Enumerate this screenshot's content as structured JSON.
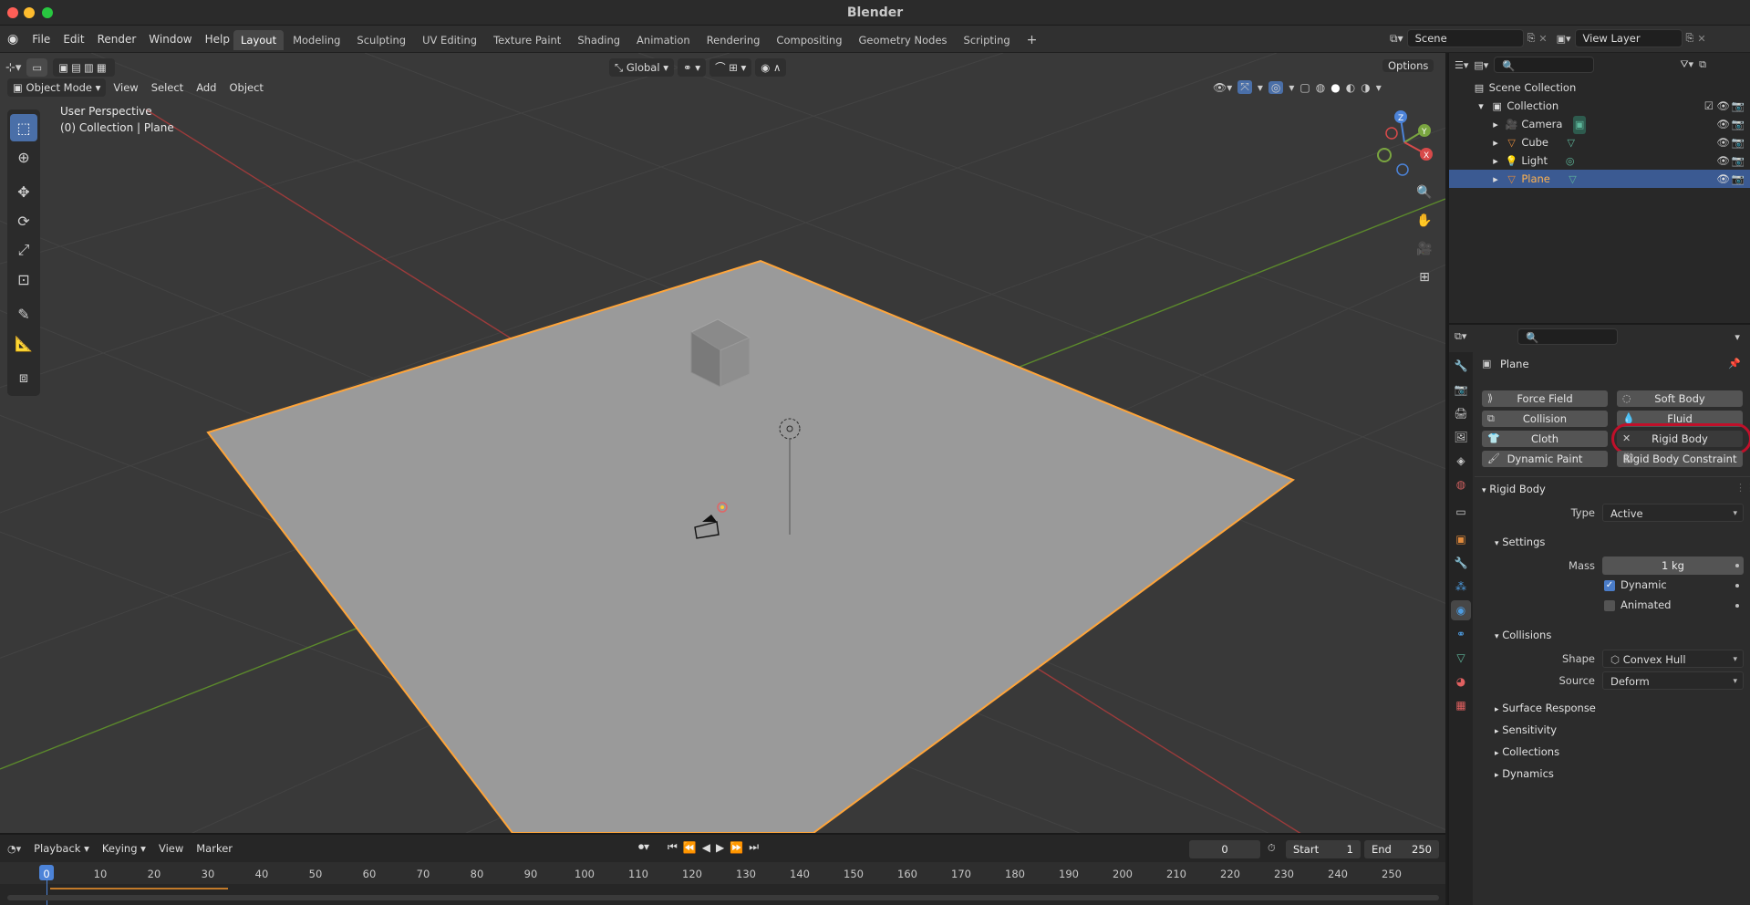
{
  "window": {
    "title": "Blender"
  },
  "menubar": {
    "menus": [
      "File",
      "Edit",
      "Render",
      "Window",
      "Help"
    ],
    "workspaces": [
      "Layout",
      "Modeling",
      "Sculpting",
      "UV Editing",
      "Texture Paint",
      "Shading",
      "Animation",
      "Rendering",
      "Compositing",
      "Geometry Nodes",
      "Scripting"
    ],
    "active_workspace": "Layout",
    "scene": "Scene",
    "view_layer": "View Layer"
  },
  "viewport": {
    "mode": "Object Mode",
    "menus": [
      "View",
      "Select",
      "Add",
      "Object"
    ],
    "transform_orientation": "Global",
    "options_label": "Options",
    "info_line1": "User Perspective",
    "info_line2": "(0) Collection | Plane",
    "gizmo": {
      "x": "X",
      "y": "Y",
      "z": "Z"
    }
  },
  "outliner": {
    "root": "Scene Collection",
    "collection": "Collection",
    "items": [
      {
        "name": "Camera",
        "icon_color": "#e08a3c",
        "data_color": "#5fb89c"
      },
      {
        "name": "Cube",
        "icon_color": "#e08a3c",
        "data_color": "#5fb89c"
      },
      {
        "name": "Light",
        "icon_color": "#e08a3c",
        "data_color": "#5fb89c"
      },
      {
        "name": "Plane",
        "icon_color": "#e08a3c",
        "data_color": "#5fb89c",
        "selected": true
      }
    ]
  },
  "properties": {
    "object_name": "Plane",
    "physics_buttons": [
      "Force Field",
      "Soft Body",
      "Collision",
      "Fluid",
      "Cloth",
      "Rigid Body",
      "Dynamic Paint",
      "Rigid Body Constraint"
    ],
    "rigid_body_panel": "Rigid Body",
    "type_label": "Type",
    "type_value": "Active",
    "settings_panel": "Settings",
    "mass_label": "Mass",
    "mass_value": "1 kg",
    "dynamic_label": "Dynamic",
    "dynamic_checked": true,
    "animated_label": "Animated",
    "animated_checked": false,
    "collisions_panel": "Collisions",
    "shape_label": "Shape",
    "shape_value": "Convex Hull",
    "source_label": "Source",
    "source_value": "Deform",
    "subpanels": [
      "Surface Response",
      "Sensitivity",
      "Collections",
      "Dynamics"
    ],
    "highlight_color": "#c0102a"
  },
  "timeline": {
    "menus": [
      "Playback",
      "Keying",
      "View",
      "Marker"
    ],
    "current_frame": "0",
    "start_label": "Start",
    "start_value": "1",
    "end_label": "End",
    "end_value": "250",
    "ruler": [
      "0",
      "10",
      "20",
      "30",
      "40",
      "50",
      "60",
      "70",
      "80",
      "90",
      "100",
      "110",
      "120",
      "130",
      "140",
      "150",
      "160",
      "170",
      "180",
      "190",
      "200",
      "210",
      "220",
      "230",
      "240",
      "250"
    ]
  },
  "colors": {
    "accent": "#4a6fa8",
    "selection_orange": "#ffa53a",
    "frame_blue": "#4c83d8"
  }
}
